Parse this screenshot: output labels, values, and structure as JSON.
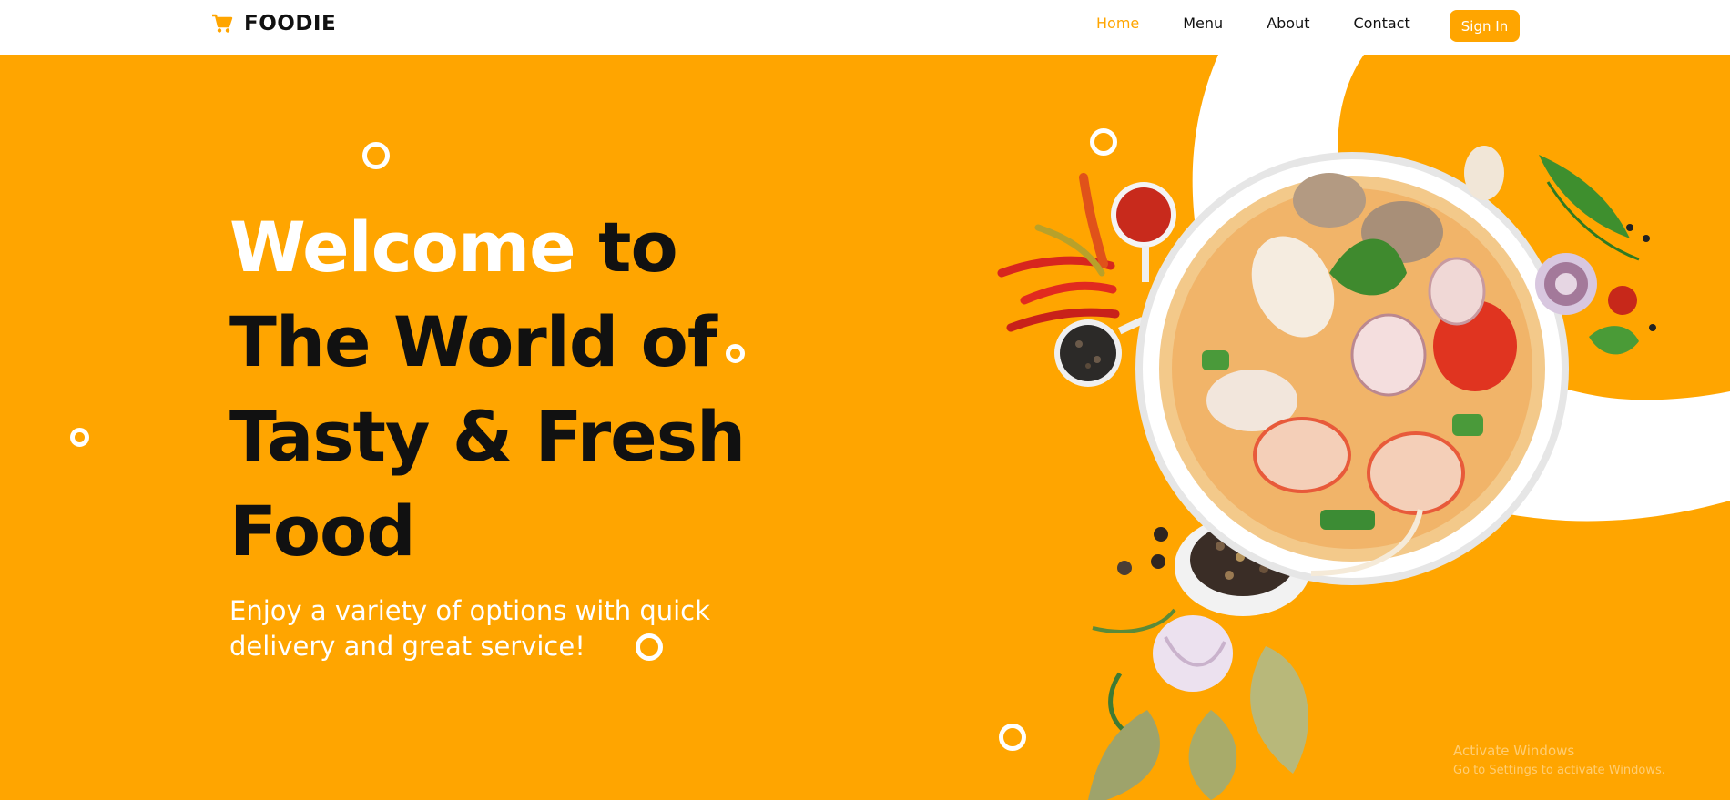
{
  "brand": {
    "name": "FOODIE",
    "icon": "shopping-cart-icon",
    "accent": "#ffa500"
  },
  "nav": {
    "items": [
      {
        "label": "Home",
        "active": true
      },
      {
        "label": "Menu",
        "active": false
      },
      {
        "label": "About",
        "active": false
      },
      {
        "label": "Contact",
        "active": false
      }
    ],
    "signin_label": "Sign In"
  },
  "hero": {
    "headline_part1": "Welcome",
    "headline_part2": " to",
    "headline_line2": "The World of",
    "headline_line3": "Tasty & Fresh",
    "headline_line4": "Food",
    "subtext": "Enjoy a variety of options with quick delivery and great service!",
    "background_color": "#ffa500",
    "image": "tom-yum-soup-bowl-with-spices"
  },
  "watermark": {
    "line1": "Activate Windows",
    "line2": "Go to Settings to activate Windows."
  }
}
